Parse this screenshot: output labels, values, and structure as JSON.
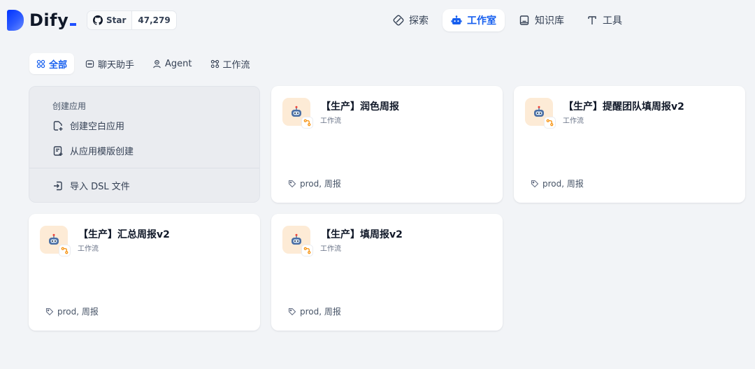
{
  "header": {
    "brand": "Dify",
    "github": {
      "star_label": "Star",
      "count": "47,279"
    },
    "nav": [
      {
        "label": "探索",
        "icon": "compass-icon",
        "active": false
      },
      {
        "label": "工作室",
        "icon": "robot-icon",
        "active": true
      },
      {
        "label": "知识库",
        "icon": "book-icon",
        "active": false
      },
      {
        "label": "工具",
        "icon": "hammer-icon",
        "active": false
      }
    ]
  },
  "tabs": [
    {
      "label": "全部",
      "icon": "grid-icon",
      "active": true
    },
    {
      "label": "聊天助手",
      "icon": "chat-icon",
      "active": false
    },
    {
      "label": "Agent",
      "icon": "agent-icon",
      "active": false
    },
    {
      "label": "工作流",
      "icon": "workflow-icon",
      "active": false
    }
  ],
  "create": {
    "title": "创建应用",
    "blank": "创建空白应用",
    "template": "从应用模版创建",
    "import_dsl": "导入 DSL 文件"
  },
  "apps": [
    {
      "name": "【生产】润色周报",
      "type": "工作流",
      "tags": "prod, 周报"
    },
    {
      "name": "【生产】提醒团队填周报v2",
      "type": "工作流",
      "tags": "prod, 周报"
    },
    {
      "name": "【生产】汇总周报v2",
      "type": "工作流",
      "tags": "prod, 周报"
    },
    {
      "name": "【生产】填周报v2",
      "type": "工作流",
      "tags": "prod, 周报"
    }
  ],
  "colors": {
    "accent": "#155eef",
    "background": "#f2f4f7",
    "app_icon_bg": "#fdebd6"
  }
}
